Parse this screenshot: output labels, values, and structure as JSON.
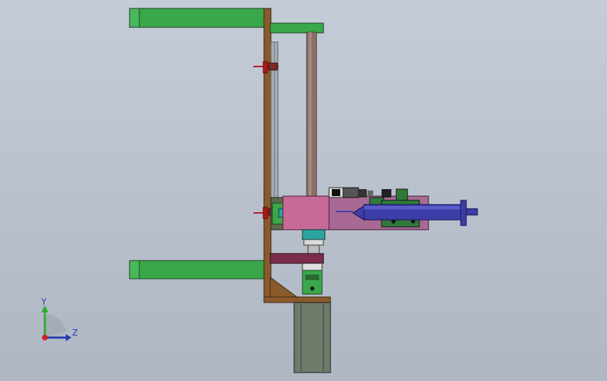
{
  "triad": {
    "y_label": "Y",
    "z_label": "Z"
  },
  "colors": {
    "background": "#bcc4d0",
    "frame_wood": "#8a5a2c",
    "green_arm": "#3aa84a",
    "green_dark": "#2f7a3a",
    "pink_block": "#c76a98",
    "column": "#8a7068",
    "cylinder_blue": "#3d3da8",
    "motor_grey": "#6f7a6a",
    "red_clamp": "#b01818",
    "teal": "#2aa6a0",
    "maroon": "#7a2c4a",
    "axis_y": "#2ab02a",
    "axis_z": "#2a3ab0",
    "axis_origin": "#d02020"
  }
}
